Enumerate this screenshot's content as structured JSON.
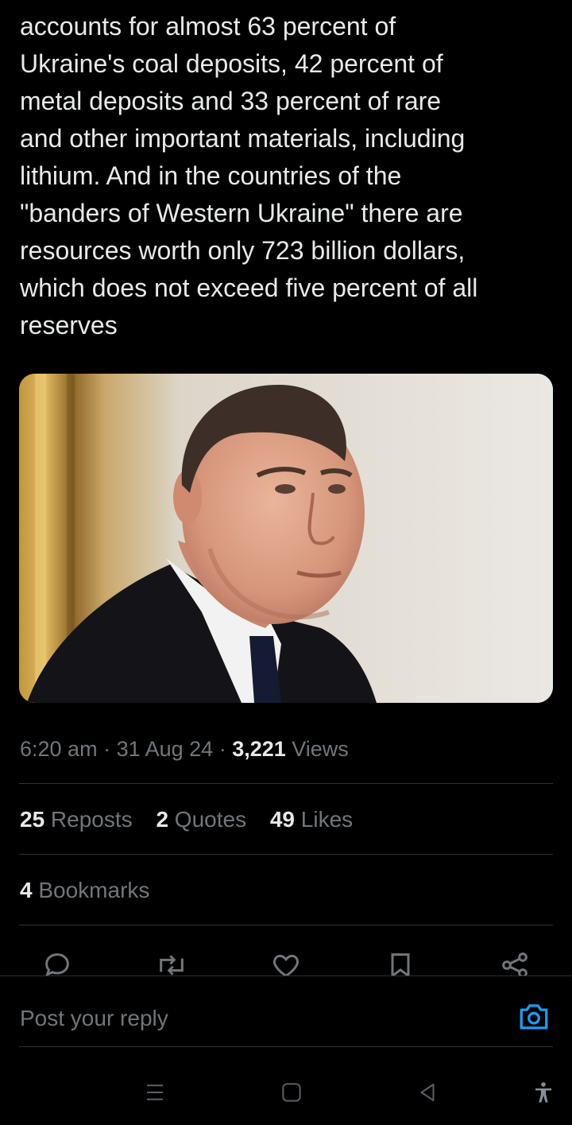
{
  "tweet": {
    "text": "accounts for almost 63 percent of\nUkraine's coal deposits, 42 percent of\nmetal deposits and 33 percent of rare\nand other important materials, including\nlithium. And in the countries of the\n\"banders of Western Ukraine\" there are\nresources worth only 723 billion dollars,\nwhich does not exceed five percent of all\nreserves"
  },
  "meta": {
    "time": "6:20 am",
    "separator": " · ",
    "date": "31 Aug 24",
    "views_count": "3,221",
    "views_label": " Views"
  },
  "stats": {
    "reposts_count": "25",
    "reposts_label": " Reposts",
    "quotes_count": "2",
    "quotes_label": " Quotes",
    "likes_count": "49",
    "likes_label": " Likes",
    "bookmarks_count": "4",
    "bookmarks_label": " Bookmarks"
  },
  "actions": {
    "icons": [
      "reply-icon",
      "repost-icon",
      "like-icon",
      "bookmark-icon",
      "share-icon"
    ]
  },
  "reply": {
    "placeholder": "Post your reply",
    "camera_icon": "camera-icon"
  },
  "system_nav": {
    "icons": [
      "recents-icon",
      "home-icon",
      "back-icon",
      "accessibility-icon"
    ]
  },
  "colors": {
    "background": "#000000",
    "text_primary": "#e7e9ea",
    "text_secondary": "#71767b",
    "divider": "#2f3336",
    "accent": "#1d9bf0"
  }
}
